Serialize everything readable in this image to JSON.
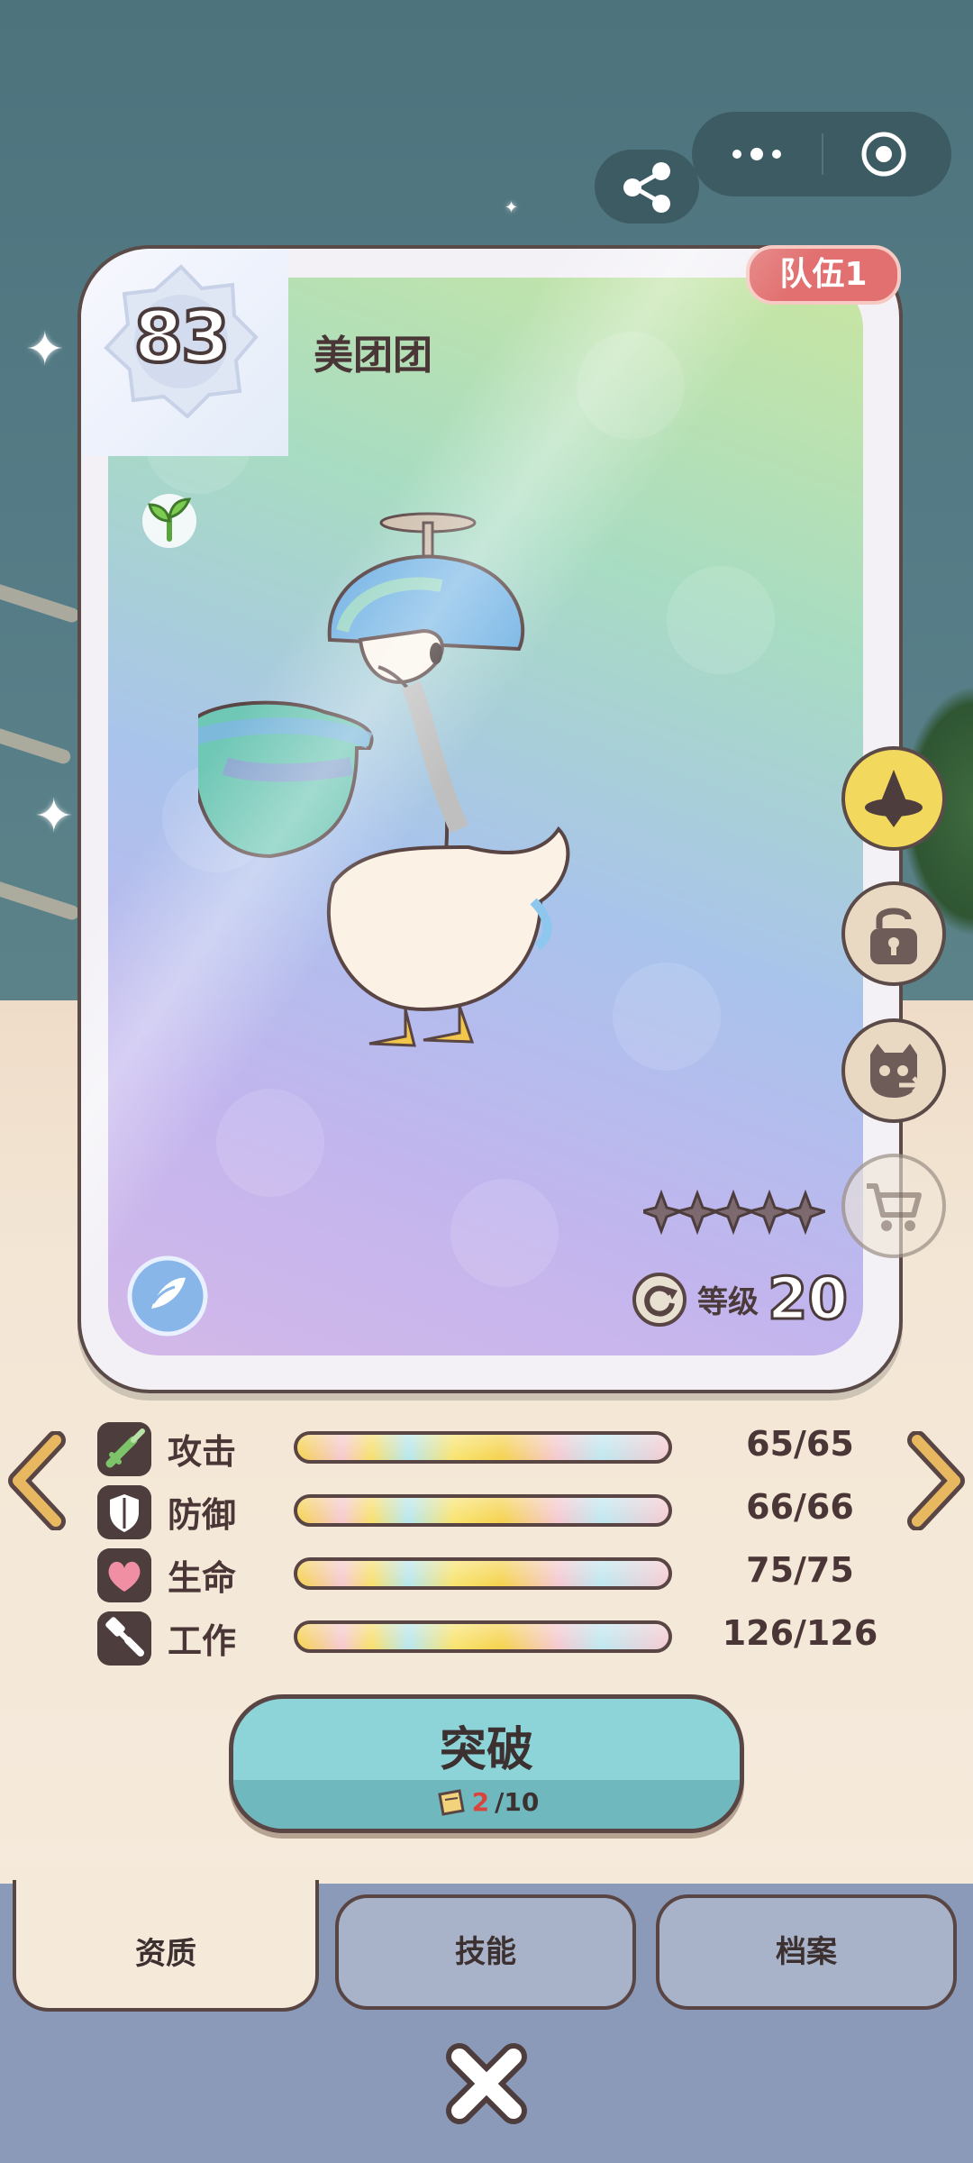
{
  "card": {
    "level": "83",
    "name": "美团团",
    "team_badge": "队伍1",
    "grade_label": "等级",
    "grade_value": "20",
    "stars_total": 5,
    "stars_filled": 0
  },
  "stats": [
    {
      "label": "攻击",
      "value": "65/65",
      "icon": "sword-icon",
      "fill": 1.0
    },
    {
      "label": "防御",
      "value": "66/66",
      "icon": "shield-icon",
      "fill": 1.0
    },
    {
      "label": "生命",
      "value": "75/75",
      "icon": "heart-icon",
      "fill": 1.0
    },
    {
      "label": "工作",
      "value": "126/126",
      "icon": "hammer-icon",
      "fill": 1.0
    }
  ],
  "breakthrough": {
    "label": "突破",
    "cost_have": "2",
    "cost_sep_total": "/10"
  },
  "tabs": {
    "active": "资质",
    "skills": "技能",
    "archive": "档案"
  },
  "colors": {
    "accent_teal": "#8cd4d8",
    "team_red": "#e27070",
    "outline": "#5a4545"
  }
}
